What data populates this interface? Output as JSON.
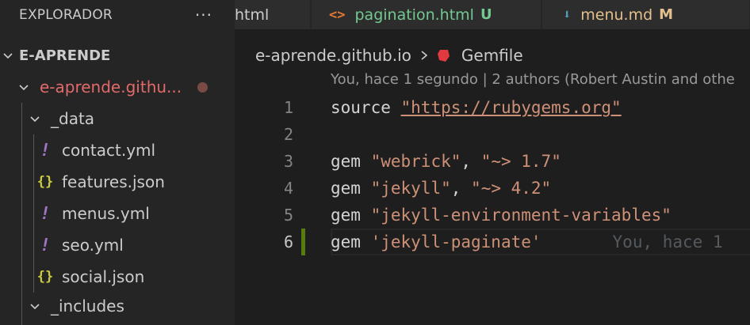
{
  "sidebar": {
    "title": "EXPLORADOR",
    "more_label": "···",
    "root": "E-APRENDE",
    "folder": "e-aprende.githu...",
    "items": [
      {
        "label": "_data",
        "type": "folder"
      },
      {
        "label": "contact.yml",
        "type": "yml"
      },
      {
        "label": "features.json",
        "type": "json"
      },
      {
        "label": "menus.yml",
        "type": "yml"
      },
      {
        "label": "seo.yml",
        "type": "yml"
      },
      {
        "label": "social.json",
        "type": "json"
      },
      {
        "label": "_includes",
        "type": "folder"
      }
    ]
  },
  "tabs": [
    {
      "label": "html",
      "status": ""
    },
    {
      "label": "pagination.html",
      "status": "U",
      "icon": "code-icon"
    },
    {
      "label": "menu.md",
      "status": "M",
      "icon": "markdown-arrow-icon"
    }
  ],
  "tab_icons": {
    "code": "<>",
    "markdown": "⬇"
  },
  "colors": {
    "untracked": "#73c991",
    "modified": "#e2c08d",
    "string": "#ce9178",
    "added_gutter": "#587c0c"
  },
  "breadcrumb": {
    "folder": "e-aprende.github.io",
    "file": "Gemfile"
  },
  "codelens": "You, hace 1 segundo | 2 authors (Robert Austin and othe",
  "editor": {
    "lines": [
      {
        "num": "1",
        "kw": "source",
        "sep1": " ",
        "s1": "\"https://rubygems.org\"",
        "sep2": "",
        "s2": ""
      },
      {
        "num": "2",
        "kw": "",
        "sep1": "",
        "s1": "",
        "sep2": "",
        "s2": ""
      },
      {
        "num": "3",
        "kw": "gem",
        "sep1": " ",
        "s1": "\"webrick\"",
        "sep2": ", ",
        "s2": "\"~> 1.7\""
      },
      {
        "num": "4",
        "kw": "gem",
        "sep1": " ",
        "s1": "\"jekyll\"",
        "sep2": ", ",
        "s2": "\"~> 4.2\""
      },
      {
        "num": "5",
        "kw": "gem",
        "sep1": " ",
        "s1": "\"jekyll-environment-variables\"",
        "sep2": "",
        "s2": ""
      },
      {
        "num": "6",
        "kw": "gem",
        "sep1": " ",
        "s1": "'jekyll-paginate'",
        "sep2": "",
        "s2": ""
      }
    ],
    "inline_blame": "You, hace 1"
  }
}
